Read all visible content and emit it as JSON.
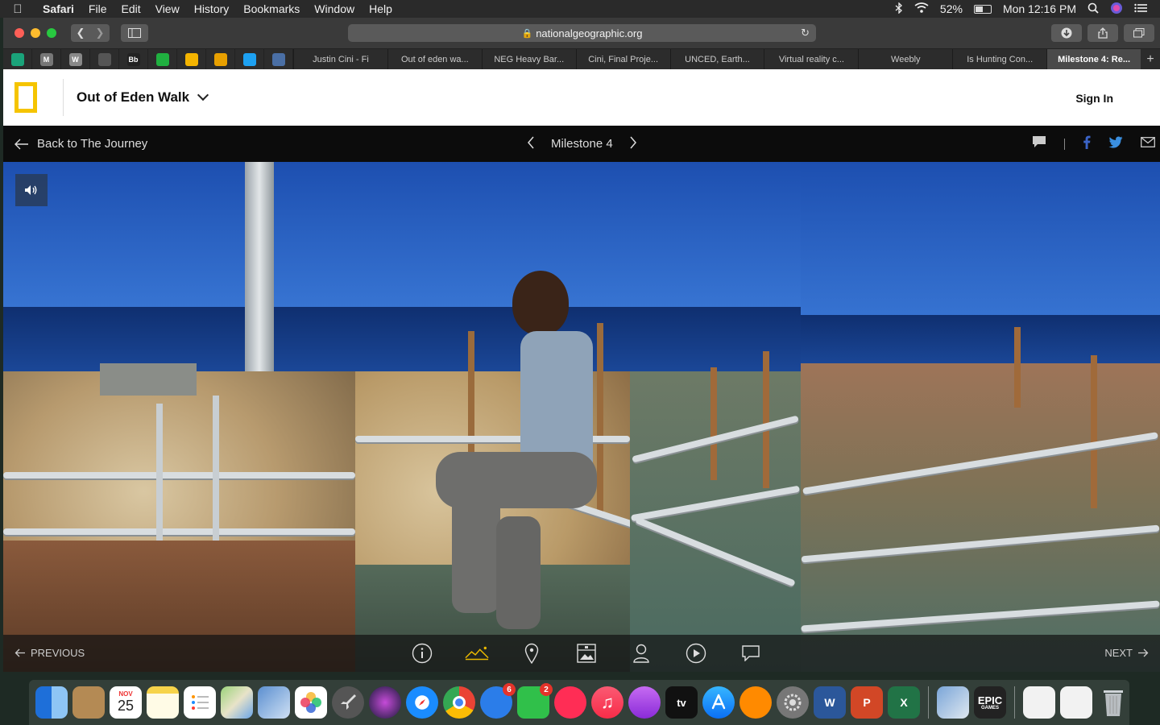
{
  "menubar": {
    "app": "Safari",
    "items": [
      "File",
      "Edit",
      "View",
      "History",
      "Bookmarks",
      "Window",
      "Help"
    ],
    "battery": "52%",
    "clock": "Mon 12:16 PM",
    "battery_level": 0.52
  },
  "browser": {
    "url": "nationalgeographic.org",
    "favorites": [
      {
        "icon": "shield-icon",
        "color": "#1aa37a"
      },
      {
        "icon": "m-icon",
        "label": "M",
        "color": "#777"
      },
      {
        "icon": "w-icon",
        "label": "W",
        "color": "#888"
      },
      {
        "icon": "building-icon",
        "color": "#555"
      },
      {
        "icon": "bb-icon",
        "label": "Bb",
        "color": "#222"
      },
      {
        "icon": "plus-circle-icon",
        "color": "#20b040"
      },
      {
        "icon": "slides-icon",
        "color": "#f4b400"
      },
      {
        "icon": "puzzle-icon",
        "color": "#e8a000"
      },
      {
        "icon": "twitter-icon",
        "color": "#1da1f2"
      },
      {
        "icon": "globe-icon",
        "color": "#4a6fa5"
      }
    ],
    "tabs": [
      {
        "title": "Justin Cini - Fi",
        "active": false
      },
      {
        "title": "Out of eden wa...",
        "active": false
      },
      {
        "title": "NEG Heavy Bar...",
        "active": false
      },
      {
        "title": "Cini, Final Proje...",
        "active": false
      },
      {
        "title": "UNCED, Earth...",
        "active": false
      },
      {
        "title": "Virtual reality c...",
        "active": false
      },
      {
        "title": "Weebly",
        "active": false
      },
      {
        "title": "Is Hunting Con...",
        "active": false
      },
      {
        "title": "Milestone 4: Re...",
        "active": true
      }
    ]
  },
  "site": {
    "title": "Out of Eden Walk",
    "signin": "Sign In",
    "back_label": "Back to The Journey",
    "milestone_label": "Milestone 4",
    "previous_label": "PREVIOUS",
    "next_label": "NEXT"
  },
  "dock": {
    "calendar_month": "NOV",
    "calendar_day": "25",
    "messages_badge": "6",
    "facetime_badge": "2",
    "epic_label": "EPIC",
    "epic_sub": "GAMES",
    "word_label": "W",
    "powerpoint_label": "P",
    "excel_label": "X",
    "appletv_label": "tv"
  }
}
